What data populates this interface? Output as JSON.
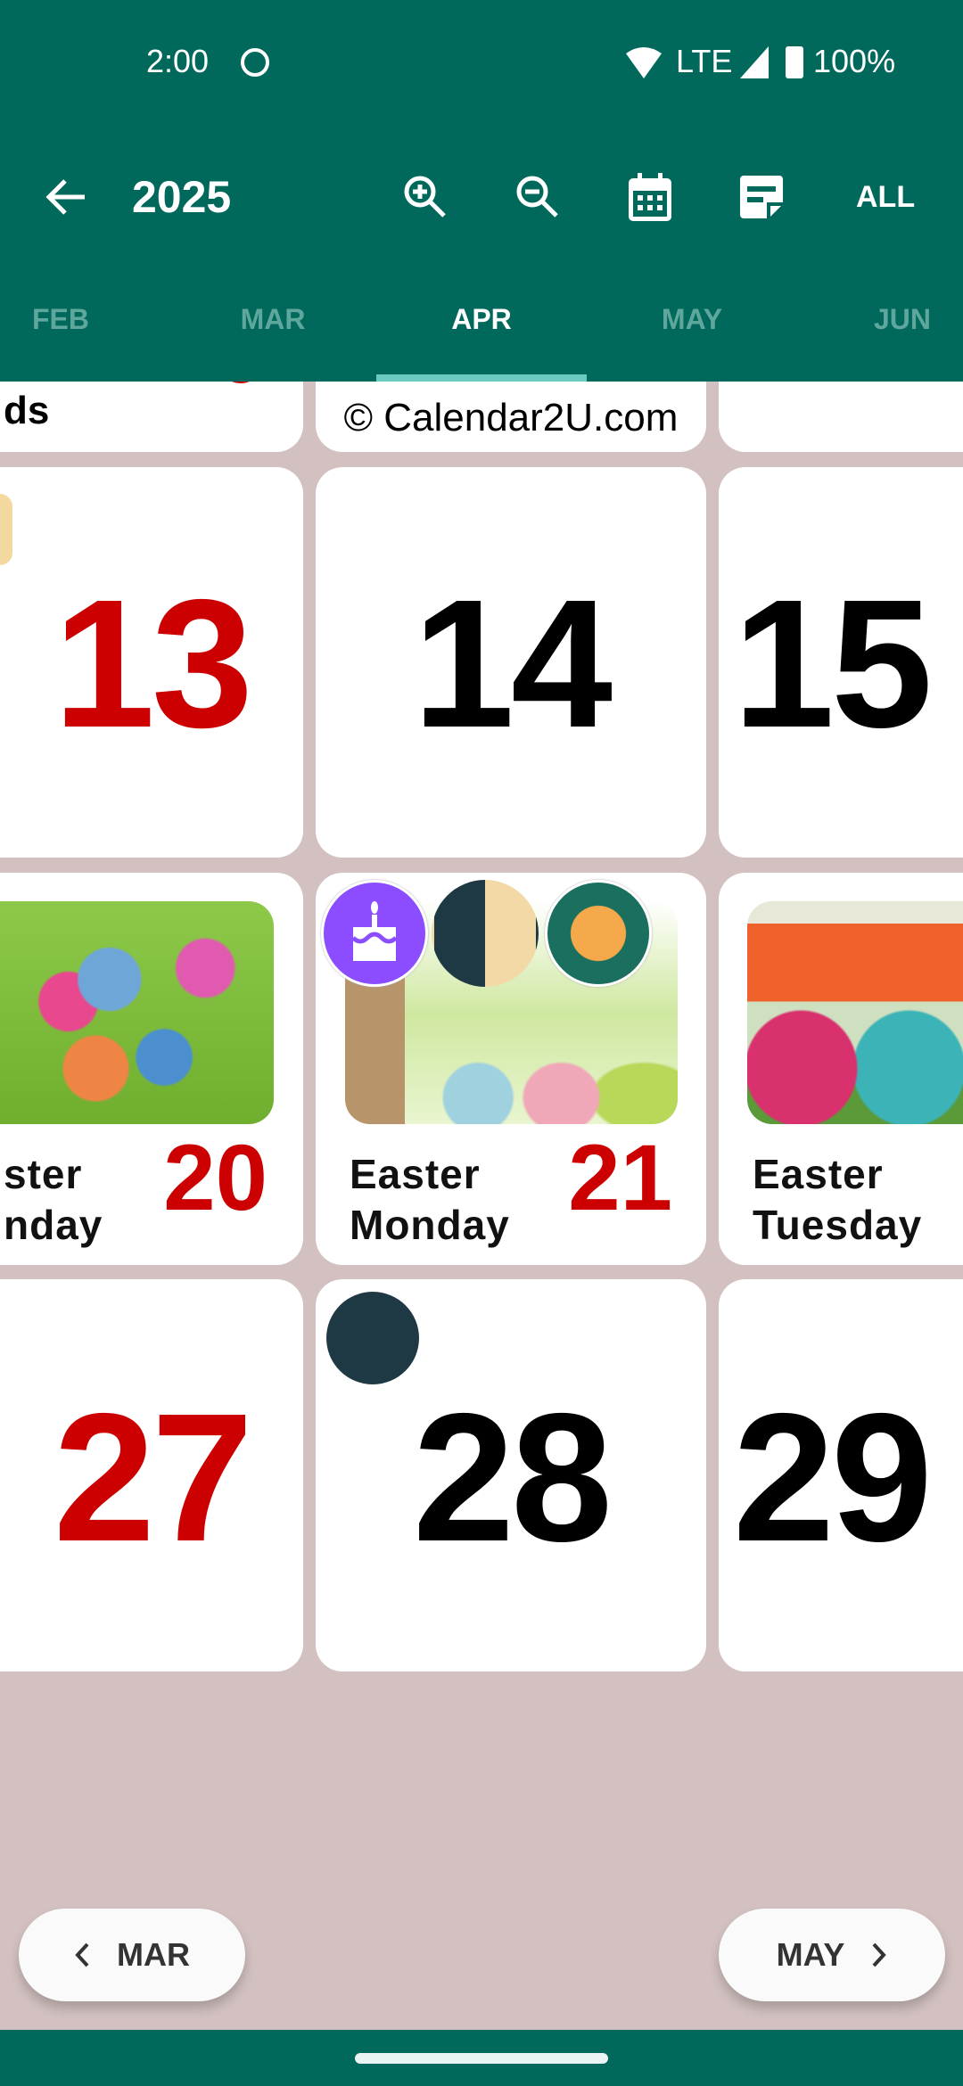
{
  "status_bar": {
    "time": "2:00",
    "network": "LTE",
    "battery": "100%"
  },
  "toolbar": {
    "title": "2025",
    "all_label": "ALL",
    "icons": [
      "arrow-back-icon",
      "zoom-in-icon",
      "zoom-out-icon",
      "calendar-icon",
      "note-icon"
    ]
  },
  "tabs": [
    {
      "label": "FEB"
    },
    {
      "label": "MAR"
    },
    {
      "label": "APR",
      "active": true
    },
    {
      "label": "MAY"
    },
    {
      "label": "JUN"
    }
  ],
  "rows": [
    {
      "cells": [
        {
          "label": "ds"
        },
        {
          "label": "© Calendar2U.com"
        },
        {
          "label": ""
        }
      ]
    },
    {
      "cells": [
        {
          "day": "13",
          "holiday": true
        },
        {
          "day": "14"
        },
        {
          "day": "15"
        }
      ]
    },
    {
      "cells": [
        {
          "day": "20",
          "label1": "ster",
          "label2": "nday",
          "holiday": true
        },
        {
          "day": "21",
          "label1": "Easter",
          "label2": "Monday",
          "holiday": true,
          "icons": [
            "birthday-cake-icon",
            "first-quarter-moon-icon",
            "pancake-icon"
          ]
        },
        {
          "label1": "Easter",
          "label2": "Tuesday"
        }
      ]
    },
    {
      "cells": [
        {
          "day": "27",
          "holiday": true
        },
        {
          "day": "28",
          "icons": [
            "new-moon-icon"
          ]
        },
        {
          "day": "29"
        }
      ]
    }
  ],
  "footer": {
    "prev_label": "MAR",
    "next_label": "MAY"
  },
  "colors": {
    "primary": "#00695c",
    "holiday": "#cc0000",
    "background": "#d3c1c1",
    "tab_indicator": "#6ccbc0"
  }
}
